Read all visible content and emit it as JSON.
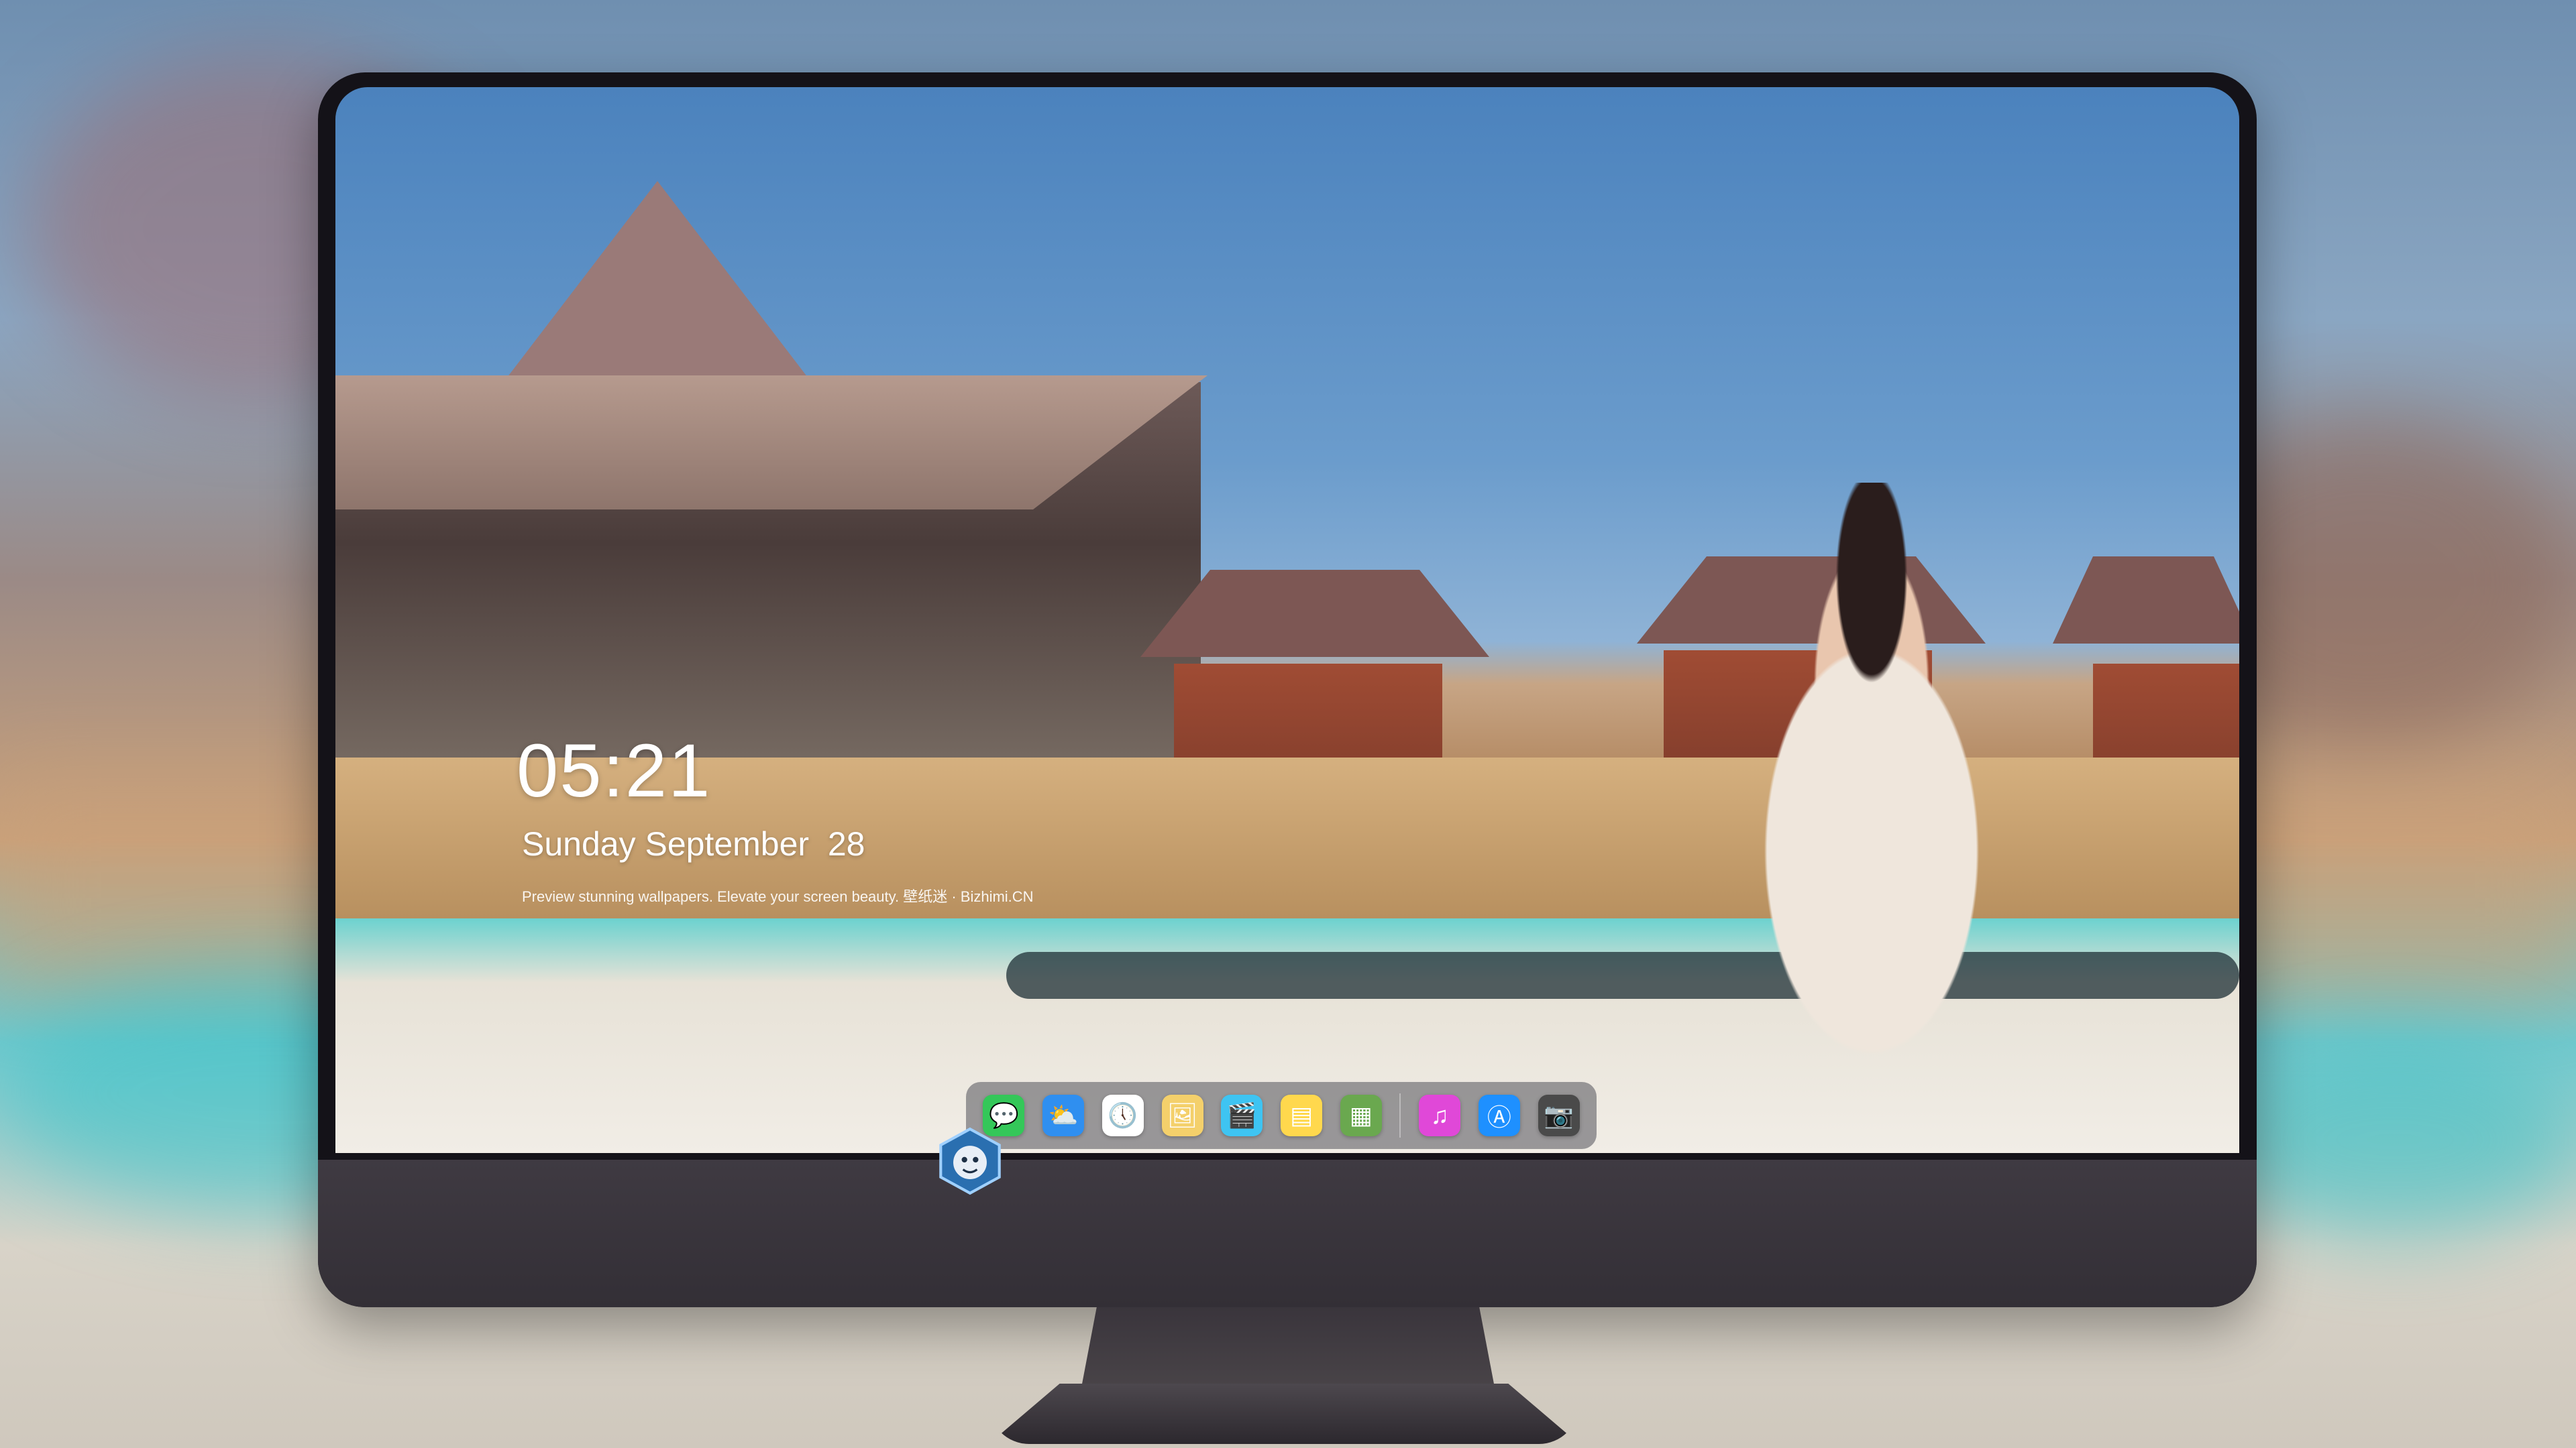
{
  "clock": {
    "time": "05:21",
    "date": "Sunday September  28",
    "tagline": "Preview stunning wallpapers. Elevate your screen beauty. 壁纸迷 · Bizhimi.CN"
  },
  "dock": {
    "icons": [
      {
        "name": "messages-icon",
        "glyph": "💬",
        "color": "#34c759"
      },
      {
        "name": "weather-icon",
        "glyph": "⛅",
        "color": "#2f8ff0"
      },
      {
        "name": "clock-icon",
        "glyph": "🕔",
        "color": "#ffffff"
      },
      {
        "name": "preview-icon",
        "glyph": "🖼",
        "color": "#f4d06b"
      },
      {
        "name": "clips-icon",
        "glyph": "🎬",
        "color": "#3ec4f2"
      },
      {
        "name": "notes-icon",
        "glyph": "▤",
        "color": "#ffd84d"
      },
      {
        "name": "photo-booth-icon",
        "glyph": "▦",
        "color": "#6aa84f"
      },
      {
        "name": "music-icon",
        "glyph": "♫",
        "color": "#e048d8"
      },
      {
        "name": "app-store-icon",
        "glyph": "Ⓐ",
        "color": "#1e90ff"
      },
      {
        "name": "camera-icon",
        "glyph": "📷",
        "color": "#4a4a4a"
      }
    ]
  },
  "colors": {
    "monitor": "#141218",
    "chin": "#3a353c",
    "accent": "#2f8ff0"
  }
}
